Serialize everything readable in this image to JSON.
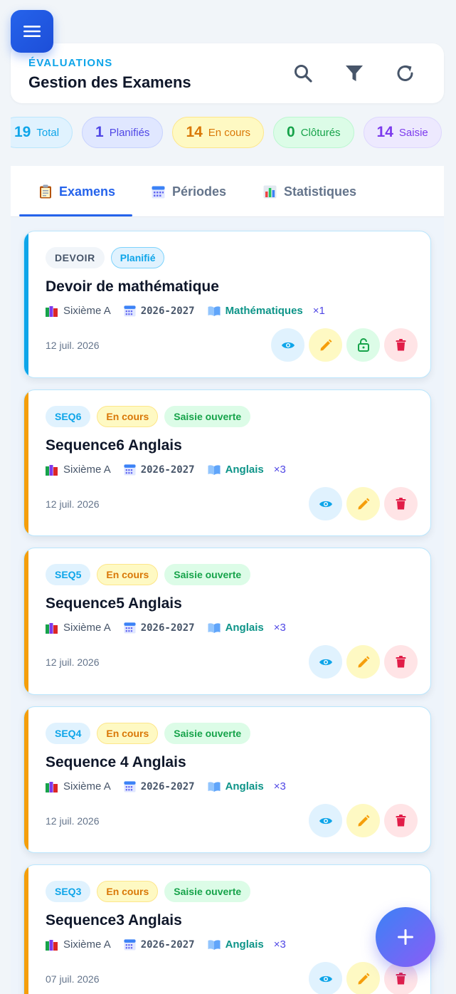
{
  "header": {
    "kicker": "ÉVALUATIONS",
    "title": "Gestion des Examens"
  },
  "stats": [
    {
      "num": "19",
      "label": "Total"
    },
    {
      "num": "1",
      "label": "Planifiés"
    },
    {
      "num": "14",
      "label": "En cours"
    },
    {
      "num": "0",
      "label": "Clôturés"
    },
    {
      "num": "14",
      "label": "Saisie"
    }
  ],
  "tabs": [
    {
      "label": "Examens",
      "icon": "clipboard-icon"
    },
    {
      "label": "Périodes",
      "icon": "calendar-icon"
    },
    {
      "label": "Statistiques",
      "icon": "bar-chart-icon"
    }
  ],
  "cards": [
    {
      "code": "DEVOIR",
      "status": "Planifié",
      "saisie": "",
      "title": "Devoir de mathématique",
      "classe": "Sixième A",
      "year": "2026-2027",
      "subject": "Mathématiques",
      "mult": "×1",
      "date": "12 juil. 2026"
    },
    {
      "code": "SEQ6",
      "status": "En cours",
      "saisie": "Saisie ouverte",
      "title": "Sequence6 Anglais",
      "classe": "Sixième A",
      "year": "2026-2027",
      "subject": "Anglais",
      "mult": "×3",
      "date": "12 juil. 2026"
    },
    {
      "code": "SEQ5",
      "status": "En cours",
      "saisie": "Saisie ouverte",
      "title": "Sequence5 Anglais",
      "classe": "Sixième A",
      "year": "2026-2027",
      "subject": "Anglais",
      "mult": "×3",
      "date": "12 juil. 2026"
    },
    {
      "code": "SEQ4",
      "status": "En cours",
      "saisie": "Saisie ouverte",
      "title": "Sequence 4 Anglais",
      "classe": "Sixième A",
      "year": "2026-2027",
      "subject": "Anglais",
      "mult": "×3",
      "date": "12 juil. 2026"
    },
    {
      "code": "SEQ3",
      "status": "En cours",
      "saisie": "Saisie ouverte",
      "title": "Sequence3 Anglais",
      "classe": "Sixième A",
      "year": "2026-2027",
      "subject": "Anglais",
      "mult": "×3",
      "date": "07 juil. 2026"
    }
  ],
  "colors": {
    "primary": "#2563eb",
    "planned_bar": "#0ea5e9",
    "in_progress_bar": "#f59e0b",
    "subject": "#0d9488"
  }
}
